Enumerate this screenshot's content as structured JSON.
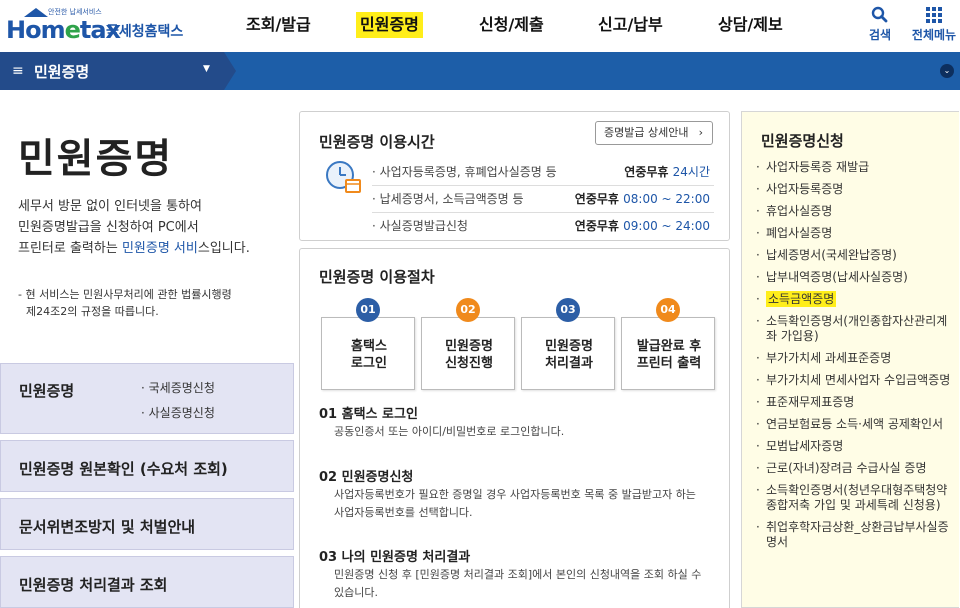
{
  "header": {
    "logo_small": "안전한 납세서비스",
    "logo_text_1": "Hom",
    "logo_text_2": "e",
    "logo_text_3": "tax",
    "logo_sub": "국세청홈택스",
    "nav": [
      "조회/발급",
      "민원증명",
      "신청/제출",
      "신고/납부",
      "상담/제보"
    ],
    "active_nav": "민원증명",
    "search_label": "검색",
    "all_menu_label": "전체메뉴"
  },
  "subbar": {
    "title": "민원증명",
    "menu_icon": "≡",
    "caret": "▼",
    "right_icon": "⌄"
  },
  "left": {
    "title": "민원증명",
    "intro_1": "세무서 방문 없이 인터넷을 통하여",
    "intro_2": "민원증명발급을 신청하여 PC에서",
    "intro_3a": "프린터로 출력하는 ",
    "intro_3b": "민원증명 서비",
    "intro_3c": "스입니다.",
    "notice_1": "- 현 서비스는 민원사무처리에 관한 법률시행령",
    "notice_2": "제24조2의 규정을 따릅니다.",
    "boxes": {
      "b1_title": "민원증명",
      "b1_sub1": "· 국세증명신청",
      "b1_sub2": "· 사실증명신청",
      "b2_title": "민원증명 원본확인 (수요처 조회)",
      "b3_title": "문서위변조방지 및 처벌안내",
      "b4_title": "민원증명 처리결과 조회"
    }
  },
  "usage_time": {
    "title": "민원증명 이용시간",
    "detail_button": "증명발급 상세안내",
    "detail_arrow": "›",
    "rows": [
      {
        "name": "· 사업자등록증명, 휴폐업사실증명 등",
        "prefix": "연중무휴 ",
        "time": "24시간"
      },
      {
        "name": "· 납세증명서, 소득금액증명 등",
        "prefix": "연중무휴 ",
        "time": "08:00 ~ 22:00"
      },
      {
        "name": "· 사실증명발급신청",
        "prefix": "연중무휴 ",
        "time": "09:00 ~ 24:00"
      }
    ]
  },
  "procedure": {
    "title": "민원증명 이용절차",
    "steps": [
      {
        "num": "01",
        "line1": "홈택스",
        "line2": "로그인",
        "color": "#2c5ea6"
      },
      {
        "num": "02",
        "line1": "민원증명",
        "line2": "신청진행",
        "color": "#f08a1c"
      },
      {
        "num": "03",
        "line1": "민원증명",
        "line2": "처리결과",
        "color": "#2c5ea6"
      },
      {
        "num": "04",
        "line1": "발급완료 후",
        "line2": "프린터 출력",
        "color": "#f08a1c"
      }
    ],
    "details": [
      {
        "head": "01 홈택스 로그인",
        "desc": "공동인증서 또는 아이디/비밀번호로 로그인합니다."
      },
      {
        "head": "02 민원증명신청",
        "desc": "사업자등록번호가 필요한 증명일 경우 사업자등록번호 목록 중 발급받고자 하는 사업자등록번호를 선택합니다."
      },
      {
        "head": "03 나의 민원증명 처리결과",
        "desc": "민원증명 신청 후 [민원증명 처리결과 조회]에서 본인의 신청내역을 조회 하실 수 있습니다."
      }
    ]
  },
  "right": {
    "title": "민원증명신청",
    "items": [
      "사업자등록증 재발급",
      "사업자등록증명",
      "휴업사실증명",
      "폐업사실증명",
      "납세증명서(국세완납증명)",
      "납부내역증명(납세사실증명)",
      "소득금액증명",
      "소득확인증명서(개인종합자산관리계좌 가입용)",
      "부가가치세 과세표준증명",
      "부가가치세 면세사업자 수입금액증명",
      "표준재무제표증명",
      "연금보험료등 소득·세액 공제확인서",
      "모범납세자증명",
      "근로(자녀)장려금 수급사실 증명",
      "소득확인증명서(청년우대형주택청약종합저축 가입 및 과세특례 신청용)",
      "취업후학자금상환_상환금납부사실증명서"
    ],
    "highlighted": "소득금액증명"
  },
  "colors": {
    "brand_blue": "#1e56a8",
    "highlight_yellow": "#ffee1a",
    "step_blue": "#2c5ea6",
    "step_orange": "#f08a1c"
  }
}
